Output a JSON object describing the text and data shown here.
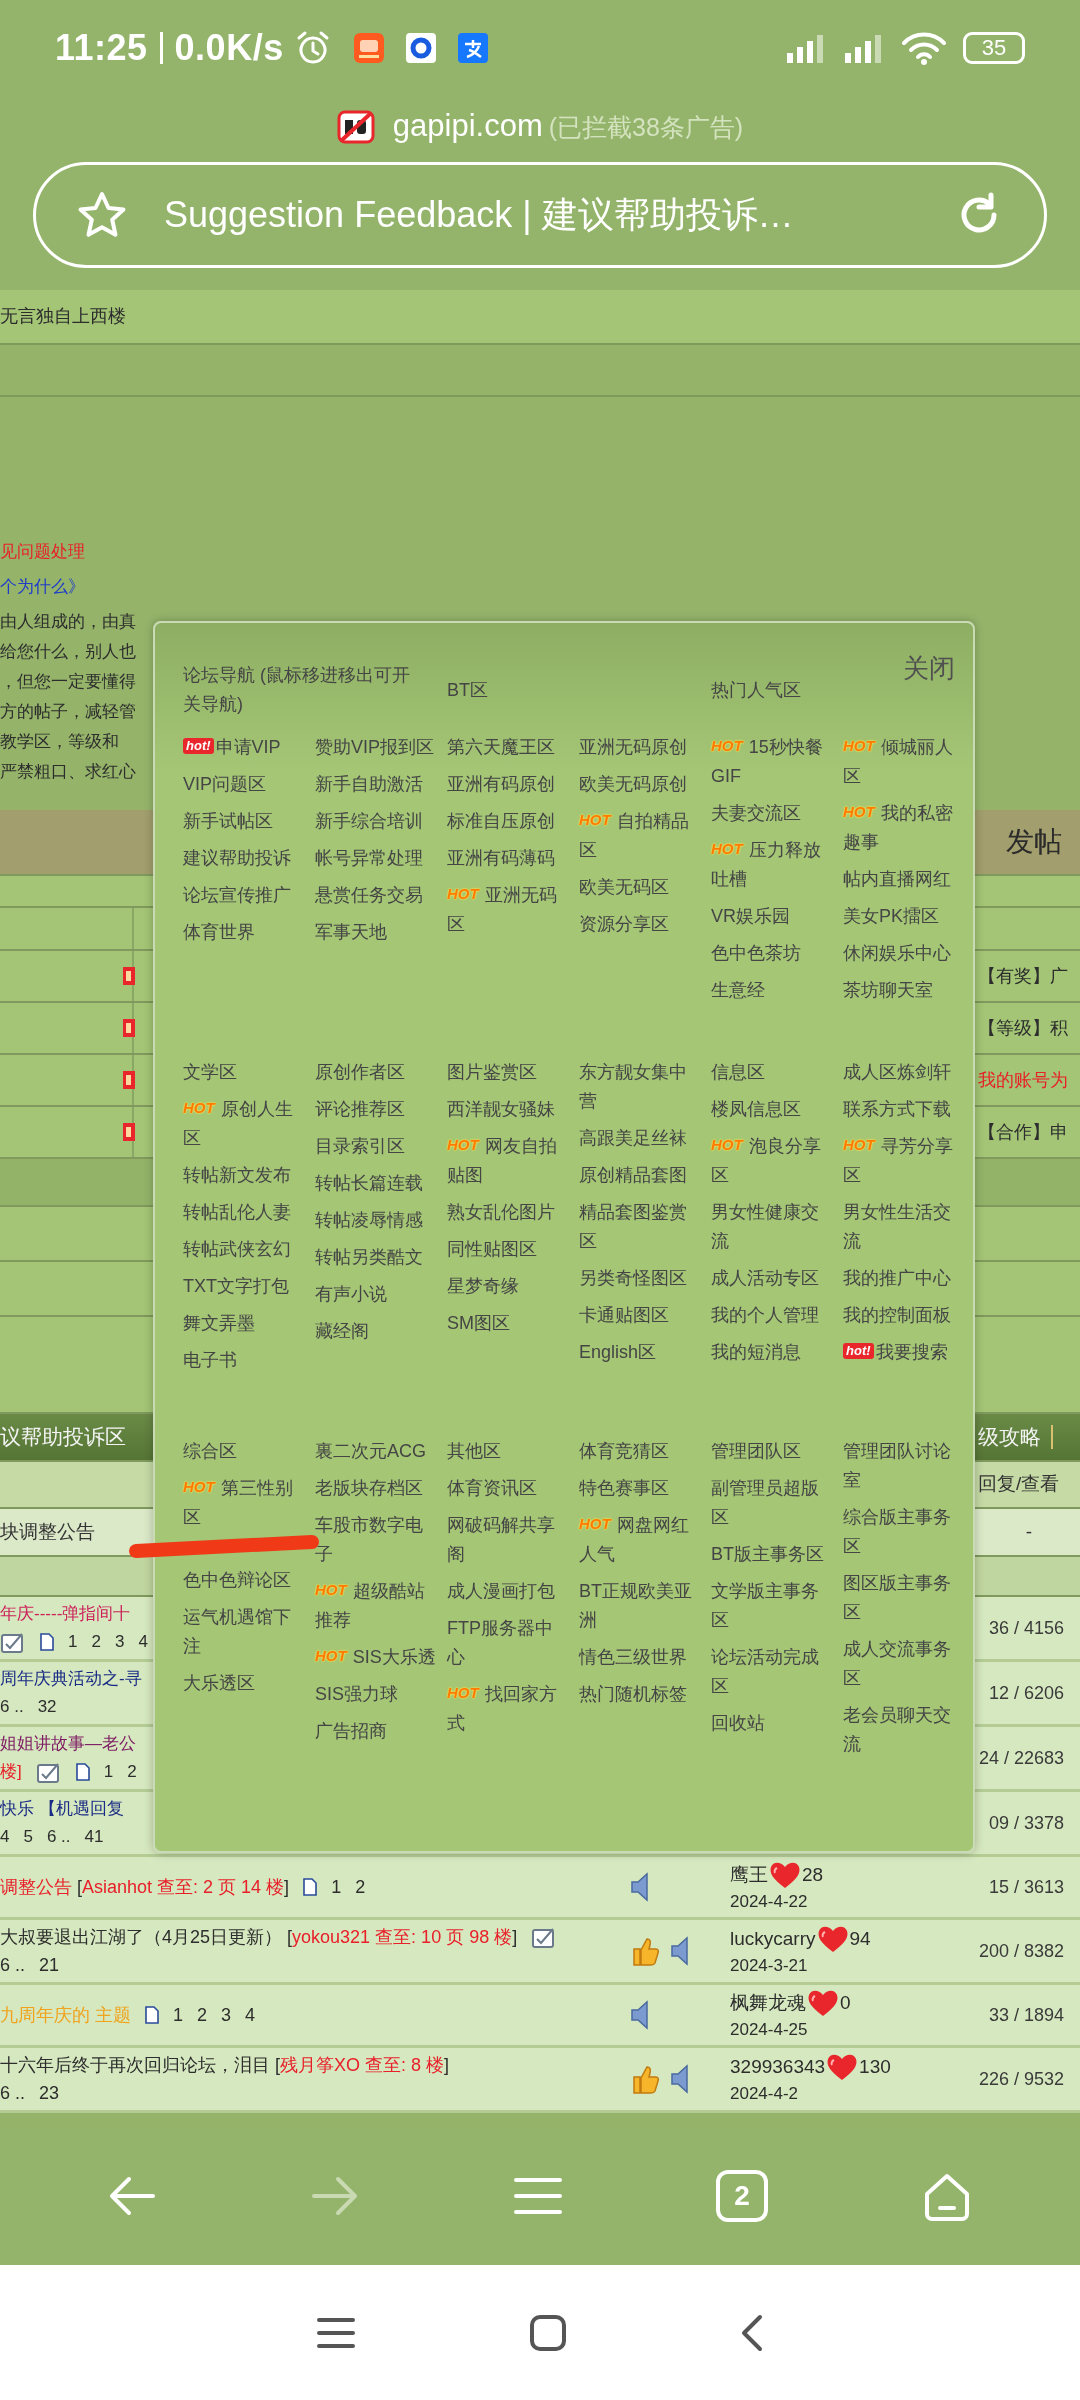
{
  "status_bar": {
    "time": "11:25",
    "speed": "0.0K/s",
    "battery": "35"
  },
  "site": {
    "domain": "gapipi.com",
    "note": "(已拦截38条广告)"
  },
  "address_bar": {
    "title": "Suggestion Feedback | 建议帮助投诉…"
  },
  "page": {
    "top_line": "无言独自上西楼",
    "intro": [
      {
        "kind": "red",
        "text": "见问题处理"
      },
      {
        "kind": "link",
        "text": "个为什么》"
      },
      {
        "kind": "plain",
        "text": "由人组成的，由真"
      },
      {
        "kind": "plain",
        "text": "给您什么，别人也"
      },
      {
        "kind": "plain",
        "text": "，但您一定要懂得"
      },
      {
        "kind": "plain",
        "text": "方的帖子，减轻管"
      },
      {
        "kind": "plain",
        "text": "教学区，等级和"
      },
      {
        "kind": "plain",
        "text": "严禁粗口、求红心"
      }
    ],
    "post_tip": "发帖",
    "announcements": [
      {
        "kind": "plain",
        "text": "【有奖】广"
      },
      {
        "kind": "plain",
        "text": "【等级】积"
      },
      {
        "kind": "red",
        "text": "我的账号为"
      },
      {
        "kind": "plain",
        "text": "【合作】申"
      }
    ],
    "forum_bar": {
      "title": "议帮助投诉区",
      "right": "级攻略"
    },
    "columns_row": {
      "label": "回复/查看"
    },
    "pinned": {
      "title": "块调整公告",
      "stats": "-"
    },
    "threads": [
      {
        "lines": [
          [
            {
              "kind": "magenta",
              "text": "年庆-----弹指间十"
            }
          ],
          [
            {
              "kind": "note-icon"
            },
            {
              "kind": "page-icon"
            },
            {
              "kind": "page",
              "text": "1"
            },
            {
              "kind": "page",
              "text": "2"
            },
            {
              "kind": "page",
              "text": "3"
            },
            {
              "kind": "page",
              "text": "4"
            }
          ]
        ],
        "stats": "36 / 4156"
      },
      {
        "lines": [
          [
            {
              "kind": "navy",
              "text": "周年庆典活动之-寻"
            }
          ],
          [
            {
              "kind": "page",
              "text": "6 .."
            },
            {
              "kind": "page",
              "text": "32"
            }
          ]
        ],
        "stats": "12 / 6206"
      },
      {
        "lines": [
          [
            {
              "kind": "purple",
              "text": "姐姐讲故事—老公"
            }
          ],
          [
            {
              "kind": "red",
              "text": "楼]"
            },
            {
              "kind": "note-icon"
            },
            {
              "kind": "page-icon"
            },
            {
              "kind": "page",
              "text": "1"
            },
            {
              "kind": "page",
              "text": "2"
            }
          ]
        ],
        "stats": "24 / 22683"
      },
      {
        "lines": [
          [
            {
              "kind": "navy",
              "text": "快乐 【机遇回复"
            }
          ],
          [
            {
              "kind": "page",
              "text": "4"
            },
            {
              "kind": "page",
              "text": "5"
            },
            {
              "kind": "page",
              "text": "6 .."
            },
            {
              "kind": "page",
              "text": "41"
            }
          ]
        ],
        "stats": "09 / 3378"
      },
      {
        "lines": [
          [
            {
              "kind": "red",
              "text": "调整公告"
            },
            {
              "kind": "plain",
              "text": " ["
            },
            {
              "kind": "red",
              "text": "Asianhot 查至: 2 页 14 楼"
            },
            {
              "kind": "plain",
              "text": "]"
            },
            {
              "kind": "page-icon"
            },
            {
              "kind": "page",
              "text": "1"
            },
            {
              "kind": "page",
              "text": "2"
            }
          ]
        ],
        "thumb": false,
        "audio": true,
        "user": {
          "name": "鹰王",
          "score": "28",
          "date": "2024-4-22"
        },
        "stats": "15 / 3613"
      },
      {
        "lines": [
          [
            {
              "kind": "plain",
              "text": "大叔要退出江湖了（4月25日更新） ["
            },
            {
              "kind": "red",
              "text": "yokou321 查至: 10 页 98 楼"
            },
            {
              "kind": "plain",
              "text": "]"
            },
            {
              "kind": "note-icon"
            }
          ],
          [
            {
              "kind": "page",
              "text": "6 .."
            },
            {
              "kind": "page",
              "text": "21"
            }
          ]
        ],
        "thumb": true,
        "audio": true,
        "user": {
          "name": "luckycarry",
          "score": "94",
          "date": "2024-3-21"
        },
        "stats": "200 / 8382"
      },
      {
        "lines": [
          [
            {
              "kind": "orange",
              "text": "九周年庆的 主题"
            },
            {
              "kind": "page-icon"
            },
            {
              "kind": "page",
              "text": "1"
            },
            {
              "kind": "page",
              "text": "2"
            },
            {
              "kind": "page",
              "text": "3"
            },
            {
              "kind": "page",
              "text": "4"
            }
          ]
        ],
        "thumb": false,
        "audio": true,
        "user": {
          "name": "枫舞龙魂",
          "score": "0",
          "date": "2024-4-25"
        },
        "stats": "33 / 1894"
      },
      {
        "lines": [
          [
            {
              "kind": "plain",
              "text": "十六年后终于再次回归论坛，泪目 ["
            },
            {
              "kind": "red",
              "text": "残月筝XO 查至: 8 楼"
            },
            {
              "kind": "plain",
              "text": "]"
            }
          ],
          [
            {
              "kind": "page",
              "text": "6 .."
            },
            {
              "kind": "page",
              "text": "23"
            }
          ]
        ],
        "thumb": true,
        "audio": true,
        "user": {
          "name": "329936343",
          "score": "130",
          "date": "2024-4-2"
        },
        "stats": "226 / 9532"
      }
    ]
  },
  "popup": {
    "close": "关闭",
    "rows": [
      [
        {
          "title": "论坛导航 (鼠标移进移出可开关导航)",
          "columns": [
            [
              {
                "label": "申请VIP",
                "badge": {
                  "kind": "hot-red",
                  "text": "hot!"
                }
              },
              {
                "label": "VIP问题区"
              },
              {
                "label": "新手试帖区"
              },
              {
                "label": "建议帮助投诉"
              },
              {
                "label": "论坛宣传推广"
              },
              {
                "label": "体育世界"
              }
            ],
            [
              {
                "label": "赞助VIP报到区"
              },
              {
                "label": "新手自助激活"
              },
              {
                "label": "新手综合培训"
              },
              {
                "label": "帐号异常处理"
              },
              {
                "label": "悬赏任务交易"
              },
              {
                "label": "军事天地"
              }
            ]
          ]
        },
        {
          "title": "BT区",
          "columns": [
            [
              {
                "label": "第六天魔王区"
              },
              {
                "label": "亚洲有码原创"
              },
              {
                "label": "标准自压原创"
              },
              {
                "label": "亚洲有码薄码"
              },
              {
                "label": "亚洲无码区",
                "badge": {
                  "kind": "hot-orange",
                  "text": "HOT"
                }
              }
            ],
            [
              {
                "label": "亚洲无码原创"
              },
              {
                "label": "欧美无码原创"
              },
              {
                "label": "自拍精品区",
                "badge": {
                  "kind": "hot-orange",
                  "text": "HOT"
                }
              },
              {
                "label": "欧美无码区"
              },
              {
                "label": "资源分享区"
              }
            ]
          ]
        },
        {
          "title": "热门人气区",
          "columns": [
            [
              {
                "label": "15秒快餐GIF",
                "badge": {
                  "kind": "hot-orange",
                  "text": "HOT"
                }
              },
              {
                "label": "夫妻交流区"
              },
              {
                "label": "压力释放吐槽",
                "badge": {
                  "kind": "hot-orange",
                  "text": "HOT"
                }
              },
              {
                "label": "VR娱乐园"
              },
              {
                "label": "色中色茶坊"
              },
              {
                "label": "生意经"
              }
            ],
            [
              {
                "label": "倾城丽人区",
                "badge": {
                  "kind": "hot-orange",
                  "text": "HOT"
                }
              },
              {
                "label": "我的私密趣事",
                "badge": {
                  "kind": "hot-orange",
                  "text": "HOT"
                }
              },
              {
                "label": "帖内直播网红"
              },
              {
                "label": "美女PK擂区"
              },
              {
                "label": "休闲娱乐中心"
              },
              {
                "label": "茶坊聊天室"
              }
            ]
          ]
        }
      ],
      [
        {
          "title": "文学区",
          "columns": [
            [
              {
                "label": "原创人生区",
                "badge": {
                  "kind": "hot-orange",
                  "text": "HOT"
                }
              },
              {
                "label": "转帖新文发布"
              },
              {
                "label": "转帖乱伦人妻"
              },
              {
                "label": "转帖武侠玄幻"
              },
              {
                "label": "TXT文字打包"
              },
              {
                "label": "舞文弄墨"
              },
              {
                "label": "电子书"
              }
            ],
            [
              {
                "label": "原创作者区"
              },
              {
                "label": "评论推荐区"
              },
              {
                "label": "目录索引区"
              },
              {
                "label": "转帖长篇连载"
              },
              {
                "label": "转帖凌辱情感"
              },
              {
                "label": "转帖另类酷文"
              },
              {
                "label": "有声小说"
              },
              {
                "label": "藏经阁"
              }
            ]
          ]
        },
        {
          "title": "图片鉴赏区",
          "columns": [
            [
              {
                "label": "西洋靓女骚妹"
              },
              {
                "label": "网友自拍贴图",
                "badge": {
                  "kind": "hot-orange",
                  "text": "HOT"
                }
              },
              {
                "label": "熟女乱伦图片"
              },
              {
                "label": "同性贴图区"
              },
              {
                "label": "星梦奇缘"
              },
              {
                "label": "SM图区"
              }
            ],
            [
              {
                "label": "东方靓女集中营"
              },
              {
                "label": "高跟美足丝袜"
              },
              {
                "label": "原创精品套图"
              },
              {
                "label": "精品套图鉴赏区"
              },
              {
                "label": "另类奇怪图区"
              },
              {
                "label": "卡通贴图区"
              },
              {
                "label": "English区"
              }
            ]
          ]
        },
        {
          "title": "信息区",
          "columns": [
            [
              {
                "label": "楼凤信息区"
              },
              {
                "label": "泡良分享区",
                "badge": {
                  "kind": "hot-orange",
                  "text": "HOT"
                }
              },
              {
                "label": "男女性健康交流"
              },
              {
                "label": "成人活动专区"
              },
              {
                "label": "我的个人管理"
              },
              {
                "label": "我的短消息"
              }
            ],
            [
              {
                "label": "成人区炼剑轩"
              },
              {
                "label": "联系方式下载"
              },
              {
                "label": "寻芳分享区",
                "badge": {
                  "kind": "hot-orange",
                  "text": "HOT"
                }
              },
              {
                "label": "男女性生活交流"
              },
              {
                "label": "我的推广中心"
              },
              {
                "label": "我的控制面板"
              },
              {
                "label": "我要搜索",
                "badge": {
                  "kind": "hot-red",
                  "text": "hot!"
                }
              }
            ]
          ]
        }
      ],
      [
        {
          "title": "综合区",
          "columns": [
            [
              {
                "label": "第三性别区",
                "badge": {
                  "kind": "hot-orange",
                  "text": "HOT"
                }
              },
              {
                "label": "色中色辩论区"
              },
              {
                "label": "运气机遇馆下注"
              },
              {
                "label": "大乐透区"
              }
            ],
            [
              {
                "label": "裏二次元ACG"
              },
              {
                "label": "老版块存档区"
              },
              {
                "label": "车股市数字电子"
              },
              {
                "label": "超级酷站推荐",
                "badge": {
                  "kind": "hot-orange",
                  "text": "HOT"
                }
              },
              {
                "label": "SIS大乐透",
                "badge": {
                  "kind": "hot-orange",
                  "text": "HOT"
                }
              },
              {
                "label": "SIS强力球"
              },
              {
                "label": "广告招商"
              }
            ]
          ]
        },
        {
          "title": "其他区",
          "columns": [
            [
              {
                "label": "体育资讯区"
              },
              {
                "label": "网破码解共享阁"
              },
              {
                "label": "成人漫画打包"
              },
              {
                "label": "FTP服务器中心"
              },
              {
                "label": "找回家方式",
                "badge": {
                  "kind": "hot-orange",
                  "text": "HOT"
                }
              }
            ],
            [
              {
                "label": "体育竞猜区"
              },
              {
                "label": "特色赛事区"
              },
              {
                "label": "网盘网红人气",
                "badge": {
                  "kind": "hot-orange",
                  "text": "HOT"
                }
              },
              {
                "label": "BT正规欧美亚洲"
              },
              {
                "label": "情色三级世界"
              },
              {
                "label": "热门随机标签"
              }
            ]
          ]
        },
        {
          "title": "管理团队区",
          "columns": [
            [
              {
                "label": "副管理员超版区"
              },
              {
                "label": "BT版主事务区"
              },
              {
                "label": "文学版主事务区"
              },
              {
                "label": "论坛活动完成区"
              },
              {
                "label": "回收站"
              }
            ],
            [
              {
                "label": "管理团队讨论室"
              },
              {
                "label": "综合版主事务区"
              },
              {
                "label": "图区版主事务区"
              },
              {
                "label": "成人交流事务区"
              },
              {
                "label": "老会员聊天交流"
              }
            ]
          ]
        }
      ]
    ]
  },
  "browser_nav": {
    "tab_count": "2"
  }
}
